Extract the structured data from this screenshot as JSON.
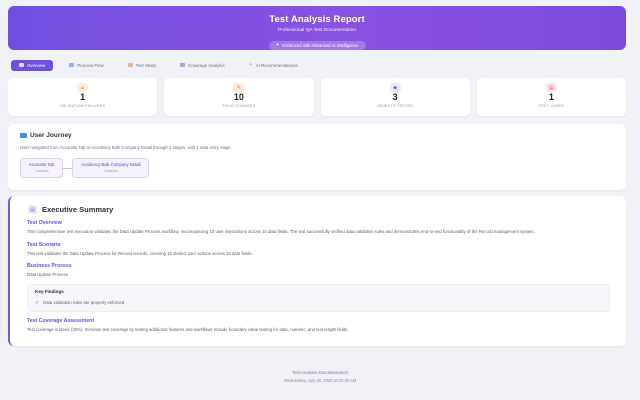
{
  "header": {
    "title": "Test Analysis Report",
    "subtitle": "Professional QA Test Documentation",
    "badge": "Enhanced with Advanced AI Intelligence",
    "colors": {
      "gradient_start": "#6f4fe0",
      "gradient_end": "#8a52e3"
    }
  },
  "tabs": [
    {
      "label": "Overview",
      "icon": "grid-icon",
      "active": true
    },
    {
      "label": "Process Flow",
      "icon": "flow-icon",
      "active": false
    },
    {
      "label": "Test Steps",
      "icon": "steps-icon",
      "active": false
    },
    {
      "label": "Coverage Analysis",
      "icon": "coverage-icon",
      "active": false
    },
    {
      "label": "AI Recommendations",
      "icon": "sparkle-icon",
      "active": false
    }
  ],
  "stats": [
    {
      "value": "1",
      "label": "VALIDATION FAILURES",
      "icon": "warning-icon",
      "color": "#f4a04a"
    },
    {
      "value": "10",
      "label": "FIELD CHANGES",
      "icon": "edit-icon",
      "color": "#e88a3a"
    },
    {
      "value": "3",
      "label": "OBJECTS TESTED",
      "icon": "objects-icon",
      "color": "#7a57e0"
    },
    {
      "value": "1",
      "label": "TEST CASES",
      "icon": "document-icon",
      "color": "#e04a7a"
    }
  ],
  "journey": {
    "title": "User Journey",
    "description": "User navigated from Accounts Tab to Accidency Bulk Company Detail through 2 stages, with 1 data entry stage.",
    "nodes": [
      {
        "title": "Accounts Tab",
        "sub": "7 actions"
      },
      {
        "title": "Accidency Bulk Company Detail",
        "sub": "3 actions"
      }
    ]
  },
  "summary": {
    "title": "Executive Summary",
    "overview_title": "Test Overview",
    "overview_text": "This comprehensive test execution validates the Data Update Process workflow, encompassing 10 user interactions across 10 data fields. The test successfully verified data validation rules and demonstrates end-to-end functionality of the Record management system.",
    "scenario_title": "Test Scenario",
    "scenario_text": "This test validates the Data Update Process for Record records, covering 10 distinct user actions across 10 data fields.",
    "process_title": "Business Process",
    "process_text": "Data Update Process",
    "findings_title": "Key Findings",
    "findings": [
      "Data validation rules are properly enforced"
    ],
    "coverage_title": "Test Coverage Assessment",
    "coverage_text": "Test coverage is Basic (30%). Increase test coverage by testing additional features and workflows Include boundary value testing for date, numeric, and text length fields"
  },
  "footer": {
    "line1": "Test Analysis Documentation",
    "line2": "Wednesday, July 30, 2025 at 02:30 AM"
  }
}
